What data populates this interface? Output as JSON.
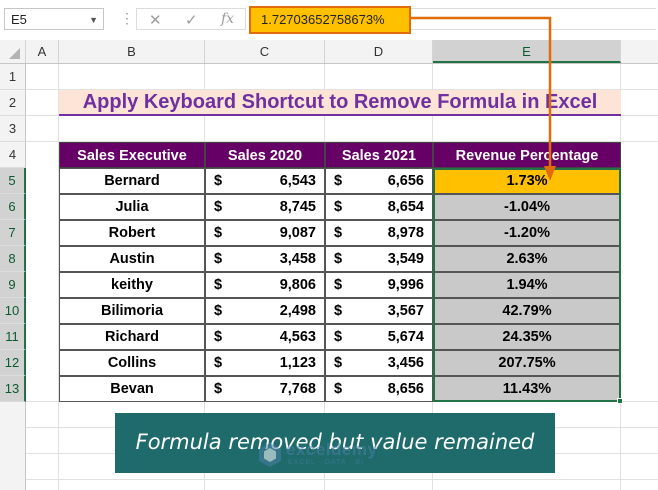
{
  "formula_bar": {
    "name_box": "E5",
    "cancel_icon": "✕",
    "enter_icon": "✓",
    "fx_icon": "fx",
    "formula_value": "1.72703652758673%"
  },
  "columns": [
    "A",
    "B",
    "C",
    "D",
    "E"
  ],
  "rows": [
    "1",
    "2",
    "3",
    "4",
    "5",
    "6",
    "7",
    "8",
    "9",
    "10",
    "11",
    "12",
    "13"
  ],
  "title": "Apply Keyboard Shortcut to Remove Formula in Excel",
  "table": {
    "headers": [
      "Sales Executive",
      "Sales 2020",
      "Sales 2021",
      "Revenue Percentage"
    ],
    "currency": "$",
    "rows": [
      {
        "name": "Bernard",
        "s2020": "6,543",
        "s2021": "6,656",
        "pct": "1.73%"
      },
      {
        "name": "Julia",
        "s2020": "8,745",
        "s2021": "8,654",
        "pct": "-1.04%"
      },
      {
        "name": "Robert",
        "s2020": "9,087",
        "s2021": "8,978",
        "pct": "-1.20%"
      },
      {
        "name": "Austin",
        "s2020": "3,458",
        "s2021": "3,549",
        "pct": "2.63%"
      },
      {
        "name": "keithy",
        "s2020": "9,806",
        "s2021": "9,996",
        "pct": "1.94%"
      },
      {
        "name": "Bilimoria",
        "s2020": "2,498",
        "s2021": "3,567",
        "pct": "42.79%"
      },
      {
        "name": "Richard",
        "s2020": "4,563",
        "s2021": "5,674",
        "pct": "24.35%"
      },
      {
        "name": "Collins",
        "s2020": "1,123",
        "s2021": "3,456",
        "pct": "207.75%"
      },
      {
        "name": "Bevan",
        "s2020": "7,768",
        "s2021": "8,656",
        "pct": "11.43%"
      }
    ]
  },
  "note": "Formula removed but value remained",
  "watermark": {
    "title": "exceldemy",
    "subtitle": "EXCEL · DATA · BI"
  },
  "colors": {
    "accent_orange": "#e36c0a",
    "highlight": "#ffc000",
    "header_purple": "#660066",
    "title_purple": "#7030a0",
    "banner": "#1f6b6b",
    "selection_green": "#217346"
  }
}
